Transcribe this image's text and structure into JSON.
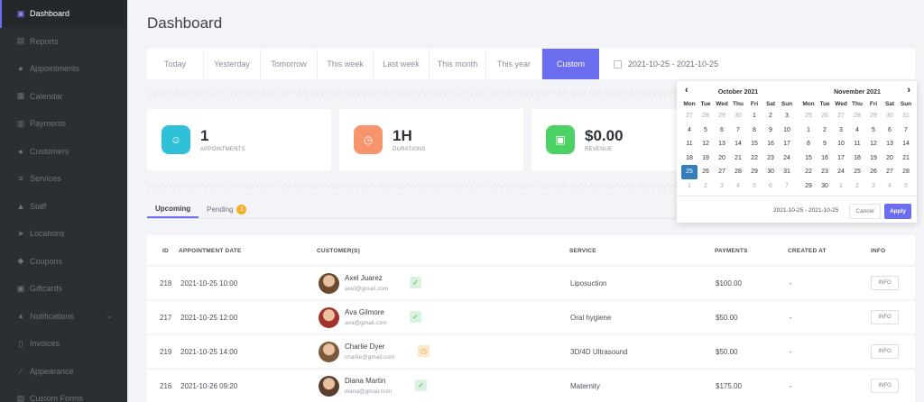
{
  "sidebar": {
    "items": [
      {
        "label": "Dashboard",
        "icon": "cube-icon",
        "glyph": "▣",
        "active": true
      },
      {
        "label": "Reports",
        "icon": "chart-icon",
        "glyph": "▤"
      },
      {
        "label": "Appointments",
        "icon": "clock-icon",
        "glyph": "●"
      },
      {
        "label": "Calendar",
        "icon": "calendar-icon",
        "glyph": "▦"
      },
      {
        "label": "Payments",
        "icon": "payments-icon",
        "glyph": "▥"
      },
      {
        "label": "Customers",
        "icon": "users-icon",
        "glyph": "●"
      },
      {
        "label": "Services",
        "icon": "services-icon",
        "glyph": "≡"
      },
      {
        "label": "Staff",
        "icon": "user-icon",
        "glyph": "▲"
      },
      {
        "label": "Locations",
        "icon": "location-arrow-icon",
        "glyph": "➤"
      },
      {
        "label": "Coupons",
        "icon": "tag-icon",
        "glyph": "◆"
      },
      {
        "label": "Giftcards",
        "icon": "gift-icon",
        "glyph": "▣"
      },
      {
        "label": "Notifications",
        "icon": "bell-icon",
        "glyph": "▴",
        "chevron": "⌄"
      },
      {
        "label": "Invoices",
        "icon": "file-icon",
        "glyph": "▯"
      },
      {
        "label": "Appearance",
        "icon": "brush-icon",
        "glyph": "∕"
      },
      {
        "label": "Custom Forms",
        "icon": "forms-icon",
        "glyph": "▤"
      }
    ]
  },
  "page_title": "Dashboard",
  "filters": {
    "tabs": [
      {
        "label": "Today"
      },
      {
        "label": "Yesterday"
      },
      {
        "label": "Tomorrow"
      },
      {
        "label": "This week"
      },
      {
        "label": "Last week"
      },
      {
        "label": "This month"
      },
      {
        "label": "This year"
      },
      {
        "label": "Custom",
        "active": true
      }
    ],
    "date_range": "2021-10-25 - 2021-10-25"
  },
  "stats": [
    {
      "value": "1",
      "label": "APPOINTMENTS",
      "color": "#2ec0d6",
      "icon": "user-icon",
      "glyph": "☺"
    },
    {
      "value": "1H",
      "label": "DURATIONS",
      "color": "#f7946b",
      "icon": "clock-icon",
      "glyph": "◷"
    },
    {
      "value": "$0.00",
      "label": "REVENUE",
      "color": "#4cd264",
      "icon": "wallet-icon",
      "glyph": "▣"
    }
  ],
  "tabs": {
    "upcoming": "Upcoming",
    "pending": "Pending",
    "pending_count": "1"
  },
  "table": {
    "headers": {
      "id": "ID",
      "date": "APPOINTMENT DATE",
      "customer": "CUSTOMER(S)",
      "service": "SERVICE",
      "payments": "PAYMENTS",
      "created": "CREATED AT",
      "info": "INFO"
    },
    "rows": [
      {
        "id": "218",
        "date": "2021-10-25 10:00",
        "name": "Axel Juarez",
        "email": "axel@gmail.com",
        "status": "approved",
        "service": "Liposuction",
        "payment": "$100.00",
        "created": "-",
        "info": "INFO"
      },
      {
        "id": "217",
        "date": "2021-10-25 12:00",
        "name": "Ava Gilmore",
        "email": "ava@gmail.com",
        "status": "approved",
        "service": "Oral hygiene",
        "payment": "$50.00",
        "created": "-",
        "info": "INFO"
      },
      {
        "id": "219",
        "date": "2021-10-25 14:00",
        "name": "Charlie Dyer",
        "email": "charlie@gmail.com",
        "status": "pending",
        "service": "3D/4D Ultrasound",
        "payment": "$50.00",
        "created": "-",
        "info": "INFO"
      },
      {
        "id": "216",
        "date": "2021-10-26 09:20",
        "name": "Diana Martin",
        "email": "diana@gmail.com",
        "status": "approved",
        "service": "Maternity",
        "payment": "$175.00",
        "created": "-",
        "info": "INFO"
      }
    ]
  },
  "calendar": {
    "months": [
      {
        "title": "October 2021",
        "days": [
          "27",
          "28",
          "29",
          "30",
          "1",
          "2",
          "3",
          "4",
          "5",
          "6",
          "7",
          "8",
          "9",
          "10",
          "11",
          "12",
          "13",
          "14",
          "15",
          "16",
          "17",
          "18",
          "19",
          "20",
          "21",
          "22",
          "23",
          "24",
          "25",
          "26",
          "27",
          "28",
          "29",
          "30",
          "31",
          "1",
          "2",
          "3",
          "4",
          "5",
          "6",
          "7"
        ],
        "off": [
          0,
          1,
          2,
          3,
          35,
          36,
          37,
          38,
          39,
          40,
          41
        ],
        "selected": 28
      },
      {
        "title": "November 2021",
        "days": [
          "25",
          "26",
          "27",
          "28",
          "29",
          "30",
          "31",
          "1",
          "2",
          "3",
          "4",
          "5",
          "6",
          "7",
          "8",
          "9",
          "10",
          "11",
          "12",
          "13",
          "14",
          "15",
          "16",
          "17",
          "18",
          "19",
          "20",
          "21",
          "22",
          "23",
          "24",
          "25",
          "26",
          "27",
          "28",
          "29",
          "30",
          "1",
          "2",
          "3",
          "4",
          "5"
        ],
        "off": [
          0,
          1,
          2,
          3,
          4,
          5,
          6,
          37,
          38,
          39,
          40,
          41
        ],
        "selected": -1
      }
    ],
    "weekdays": [
      "Mon",
      "Tue",
      "Wed",
      "Thu",
      "Fri",
      "Sat",
      "Sun"
    ],
    "range": "2021-10-25 - 2021-10-25",
    "cancel": "Cancel",
    "apply": "Apply",
    "prev": "‹",
    "next": "›"
  }
}
